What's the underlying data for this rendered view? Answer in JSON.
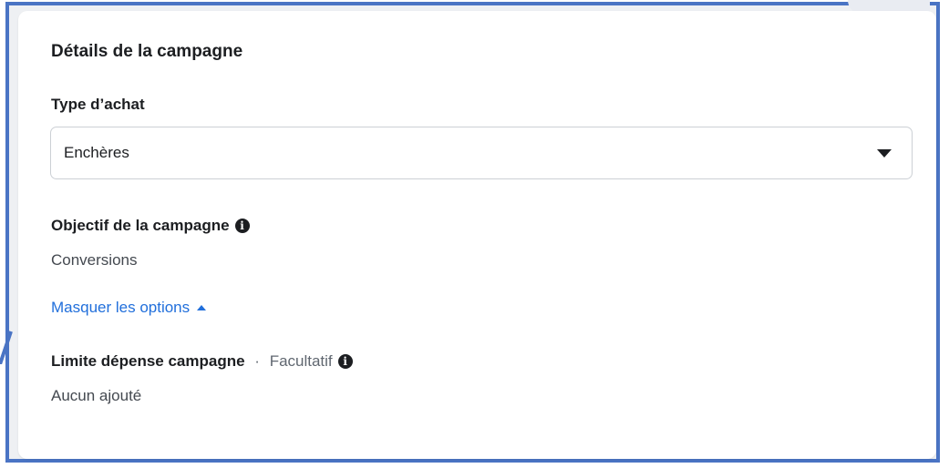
{
  "card": {
    "title": "Détails de la campagne",
    "purchase_type": {
      "label": "Type d’achat",
      "selected_value": "Enchères"
    },
    "objective": {
      "label": "Objectif de la campagne",
      "value": "Conversions"
    },
    "toggle_options_label": "Masquer les options",
    "spend_limit": {
      "label": "Limite dépense campagne",
      "separator": " · ",
      "optional_label": "Facultatif",
      "value": "Aucun ajouté"
    }
  },
  "icons": {
    "info": "info-icon",
    "dropdown": "caret-down-icon",
    "collapse": "caret-up-icon"
  },
  "colors": {
    "frame_border": "#4a74c4",
    "link": "#216fdb",
    "text": "#1c1e21"
  }
}
